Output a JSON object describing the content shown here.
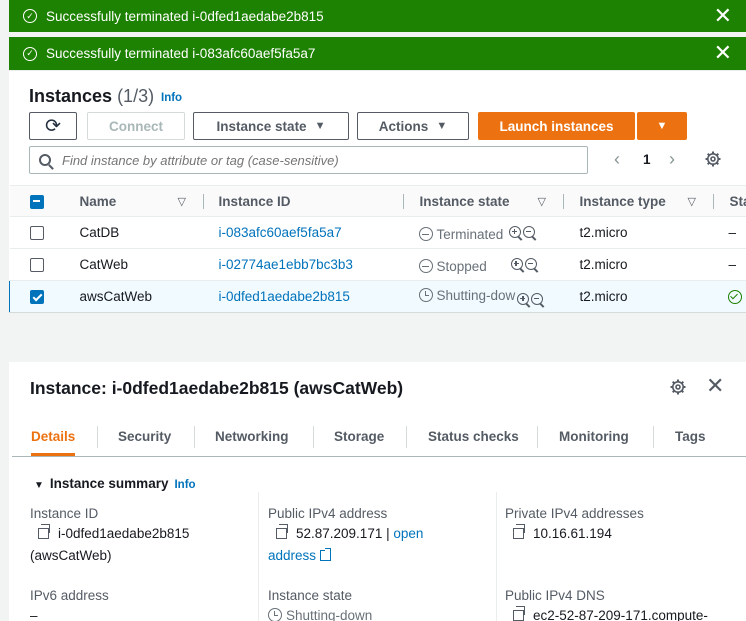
{
  "flashes": [
    {
      "message": "Successfully terminated i-0dfed1aedabe2b815",
      "close": "✕"
    },
    {
      "message": "Successfully terminated i-083afc60aef5fa5a7",
      "close": "✕"
    }
  ],
  "header": {
    "title": "Instances",
    "count": "(1/3)",
    "info": "Info"
  },
  "toolbar": {
    "refresh_icon": "⟳",
    "connect": "Connect",
    "instance_state": "Instance state",
    "actions": "Actions",
    "launch": "Launch instances",
    "dropdown_caret": "▼"
  },
  "search": {
    "placeholder": "Find instance by attribute or tag (case-sensitive)"
  },
  "pagination": {
    "prev": "‹",
    "page": "1",
    "next": "›"
  },
  "table": {
    "columns": [
      "Name",
      "Instance ID",
      "Instance state",
      "Instance type",
      "Sta"
    ],
    "rows": [
      {
        "name": "CatDB",
        "id": "i-083afc60aef5fa5a7",
        "state": "Terminated",
        "type": "t2.micro",
        "status": "–"
      },
      {
        "name": "CatWeb",
        "id": "i-02774ae1ebb7bc3b3",
        "state": "Stopped",
        "type": "t2.micro",
        "status": "–"
      },
      {
        "name": "awsCatWeb",
        "id": "i-0dfed1aedabe2b815",
        "state": "Shutting-dow",
        "type": "t2.micro",
        "status": ""
      }
    ]
  },
  "details": {
    "title": "Instance: i-0dfed1aedabe2b815 (awsCatWeb)",
    "close": "✕",
    "tabs": [
      "Details",
      "Security",
      "Networking",
      "Storage",
      "Status checks",
      "Monitoring",
      "Tags"
    ],
    "summary_title": "Instance summary",
    "summary_info": "Info",
    "fields": {
      "instance_id_label": "Instance ID",
      "instance_id_value": "i-0dfed1aedabe2b815",
      "instance_id_name": "(awsCatWeb)",
      "public_ipv4_label": "Public IPv4 address",
      "public_ipv4_value": "52.87.209.171",
      "public_ipv4_sep": "|",
      "open_address_1": "open",
      "open_address_2": "address",
      "private_ipv4_label": "Private IPv4 addresses",
      "private_ipv4_value": "10.16.61.194",
      "ipv6_label": "IPv6 address",
      "ipv6_value": "–",
      "state_label": "Instance state",
      "state_value": "Shutting-down",
      "dns_label": "Public IPv4 DNS",
      "dns_value": "ec2-52-87-209-171.compute-"
    }
  },
  "colors": {
    "success": "#1d8102",
    "accent": "#ec7211",
    "link": "#0073bb"
  }
}
